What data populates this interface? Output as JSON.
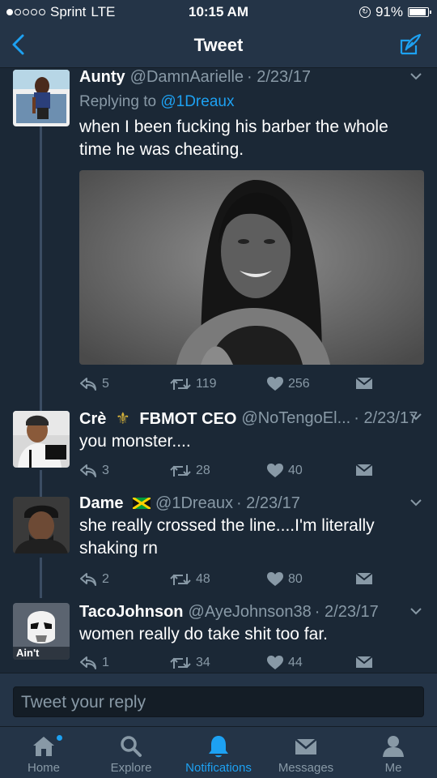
{
  "status_bar": {
    "carrier": "Sprint",
    "network": "LTE",
    "time": "10:15 AM",
    "battery": "91%",
    "battery_level": 0.91,
    "signal_bars_filled": 1,
    "signal_bars_total": 5
  },
  "nav": {
    "title": "Tweet",
    "back_icon": "chevron-left-icon",
    "compose_icon": "compose-icon"
  },
  "tweets": [
    {
      "name": "Aunty",
      "handle": "@DamnAarielle",
      "date": "· 2/23/17",
      "replying_prefix": "Replying to",
      "replying_handle": "@1Dreaux",
      "text": "when I been fucking his barber the whole time he was cheating.",
      "replies": "5",
      "retweets": "119",
      "likes": "256"
    },
    {
      "name_prefix": "Crè",
      "name_suffix": "FBMOT CEO",
      "handle": "@NoTengoEl...",
      "date": "· 2/23/17",
      "text": "you monster....",
      "replies": "3",
      "retweets": "28",
      "likes": "40"
    },
    {
      "name": "Dame",
      "handle": "@1Dreaux",
      "date": "· 2/23/17",
      "text": "she really crossed the line....I'm literally shaking rn",
      "replies": "2",
      "retweets": "48",
      "likes": "80"
    },
    {
      "name": "TacoJohnson",
      "handle": "@AyeJohnson38",
      "date": "· 2/23/17",
      "avatar_caption": "Ain't",
      "text": "women really do take shit too far.",
      "replies": "1",
      "retweets": "34",
      "likes": "44"
    }
  ],
  "reply_bar": {
    "placeholder": "Tweet your reply"
  },
  "tabs": [
    {
      "label": "Home",
      "icon": "home-icon"
    },
    {
      "label": "Explore",
      "icon": "search-icon"
    },
    {
      "label": "Notifications",
      "icon": "bell-icon"
    },
    {
      "label": "Messages",
      "icon": "envelope-icon"
    },
    {
      "label": "Me",
      "icon": "profile-icon"
    }
  ],
  "colors": {
    "background": "#1b2836",
    "bar": "#243447",
    "accent": "#1da1f2",
    "secondary_text": "#8899a6"
  }
}
